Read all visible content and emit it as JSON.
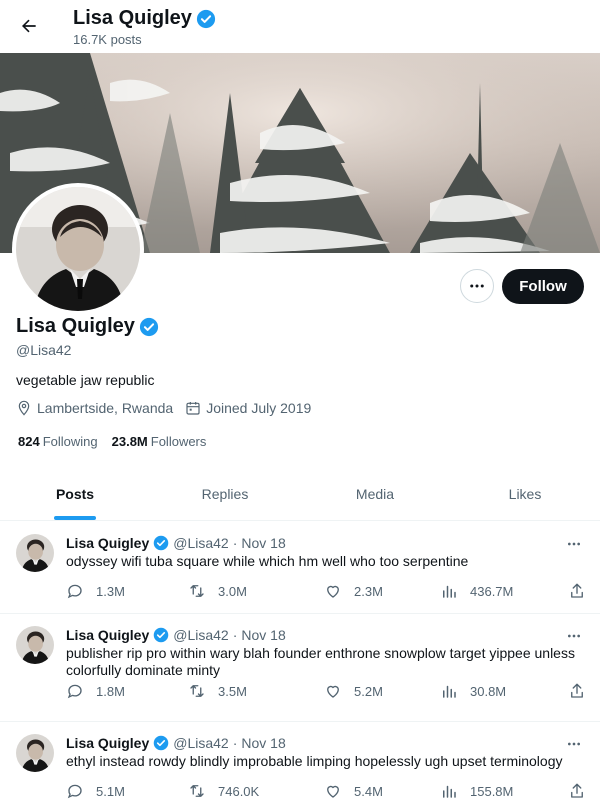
{
  "header": {
    "name": "Lisa Quigley",
    "posts_count": "16.7K posts"
  },
  "profile": {
    "name": "Lisa Quigley",
    "handle": "@Lisa42",
    "bio": "vegetable jaw republic",
    "location": "Lambertside, Rwanda",
    "joined": "Joined July 2019",
    "following_count": "824",
    "following_label": "Following",
    "followers_count": "23.8M",
    "followers_label": "Followers",
    "follow_label": "Follow"
  },
  "tabs": [
    {
      "label": "Posts",
      "active": true
    },
    {
      "label": "Replies",
      "active": false
    },
    {
      "label": "Media",
      "active": false
    },
    {
      "label": "Likes",
      "active": false
    }
  ],
  "posts": [
    {
      "name": "Lisa Quigley",
      "handle": "@Lisa42",
      "dot": "·",
      "date": "Nov 18",
      "text": "odyssey wifi tuba square while which hm well who too serpentine",
      "replies": "1.3M",
      "reposts": "3.0M",
      "likes": "2.3M",
      "views": "436.7M"
    },
    {
      "name": "Lisa Quigley",
      "handle": "@Lisa42",
      "dot": "·",
      "date": "Nov 18",
      "text": "publisher rip pro within wary blah founder enthrone snowplow target yippee unless colorfully dominate minty",
      "replies": "1.8M",
      "reposts": "3.5M",
      "likes": "5.2M",
      "views": "30.8M"
    },
    {
      "name": "Lisa Quigley",
      "handle": "@Lisa42",
      "dot": "·",
      "date": "Nov 18",
      "text": "ethyl instead rowdy blindly improbable limping hopelessly ugh upset terminology",
      "replies": "5.1M",
      "reposts": "746.0K",
      "likes": "5.4M",
      "views": "155.8M"
    }
  ],
  "colors": {
    "accent": "#1d9bf0",
    "text": "#0f1419",
    "muted": "#536471"
  }
}
